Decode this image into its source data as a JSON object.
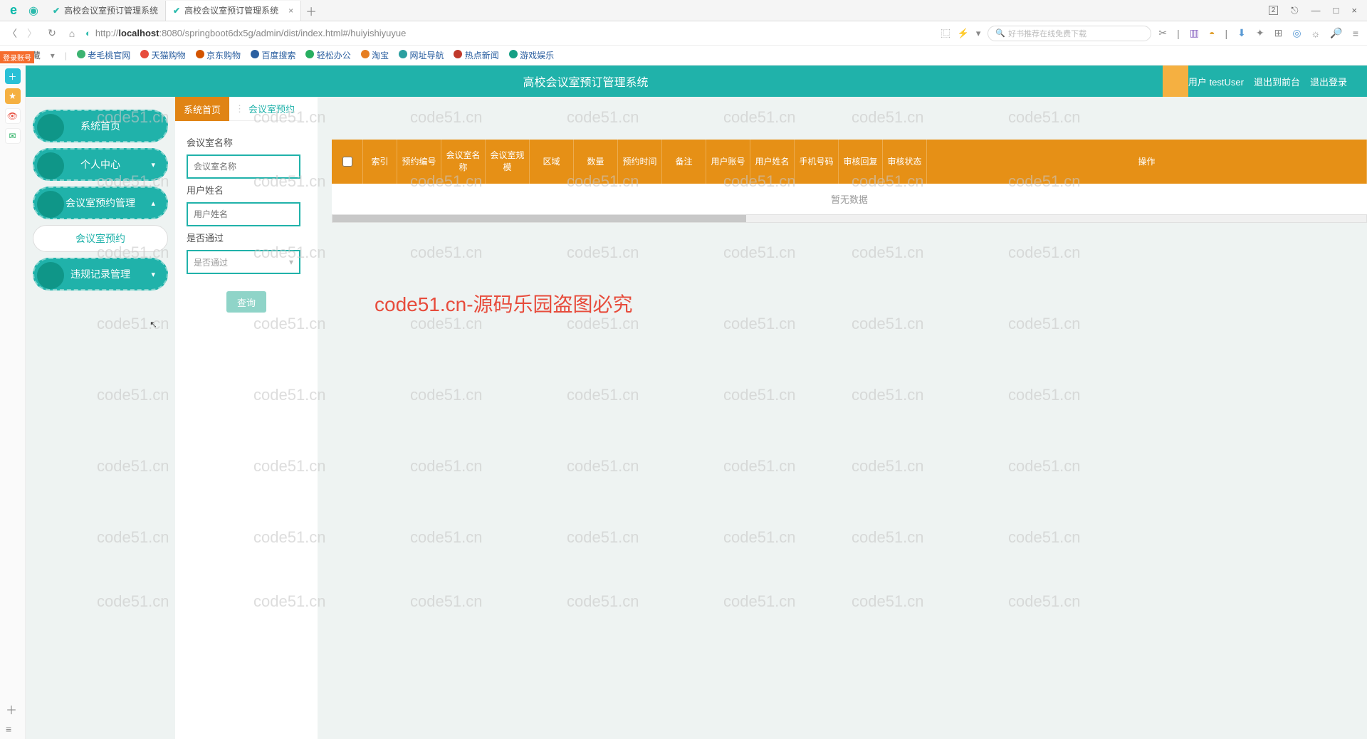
{
  "browser": {
    "tabs": [
      {
        "title": "高校会议室预订管理系统"
      },
      {
        "title": "高校会议室预订管理系统"
      }
    ],
    "window_badge": "2",
    "url_prefix": "http://",
    "url_host": "localhost",
    "url_rest": ":8080/springboot6dx5g/admin/dist/index.html#/huiyishiyuyue",
    "search_placeholder": "好书推荐在线免费下载",
    "bookmarks_label": "收藏",
    "bookmarks": [
      "老毛桃官网",
      "天猫购物",
      "京东购物",
      "百度搜索",
      "轻松办公",
      "淘宝",
      "网址导航",
      "热点新闻",
      "游戏娱乐"
    ]
  },
  "corner_badge": "登录账号",
  "app": {
    "title": "高校会议室预订管理系统",
    "user_prefix": "用户",
    "user_name": "testUser",
    "link_front": "退出到前台",
    "link_logout": "退出登录"
  },
  "menu": {
    "home": "系统首页",
    "personal": "个人中心",
    "booking_mgmt": "会议室预约管理",
    "booking_item": "会议室预约",
    "violation": "违规记录管理"
  },
  "tabs": {
    "home": "系统首页",
    "current": "会议室预约"
  },
  "form": {
    "room_label": "会议室名称",
    "room_ph": "会议室名称",
    "user_label": "用户姓名",
    "user_ph": "用户姓名",
    "pass_label": "是否通过",
    "pass_ph": "是否通过",
    "query": "查询"
  },
  "table": {
    "headers": [
      "索引",
      "预约编号",
      "会议室名称",
      "会议室规模",
      "区域",
      "数量",
      "预约时间",
      "备注",
      "用户账号",
      "用户姓名",
      "手机号码",
      "审核回复",
      "审核状态",
      "操作"
    ],
    "nodata": "暂无数据"
  },
  "watermark": "code51.cn",
  "big_watermark": "code51.cn-源码乐园盗图必究"
}
